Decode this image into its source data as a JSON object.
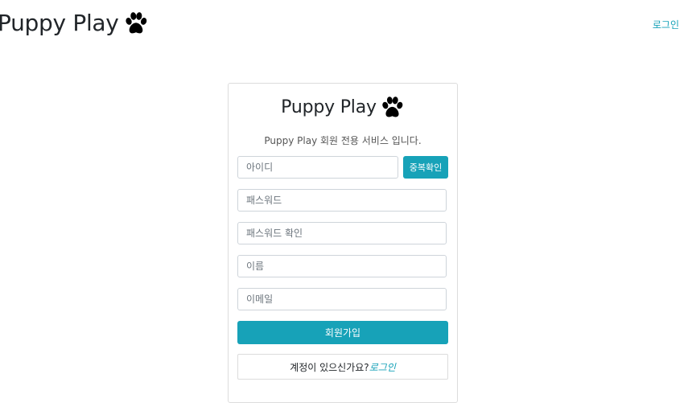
{
  "header": {
    "brand_title": "Puppy Play",
    "brand_icon": "paw-icon",
    "login_link": "로그인"
  },
  "card": {
    "title": "Puppy Play",
    "title_icon": "paw-icon",
    "subtitle": "Puppy Play 회원 전용 서비스 입니다.",
    "fields": {
      "id_placeholder": "아이디",
      "password_placeholder": "패스워드",
      "password_confirm_placeholder": "패스워드 확인",
      "name_placeholder": "이름",
      "email_placeholder": "이메일"
    },
    "check_duplicate_label": "중복확인",
    "signup_label": "회원가입",
    "account_prompt": "계정이 있으신가요?",
    "account_login_link": "로그인"
  },
  "colors": {
    "accent": "#17a2b8",
    "text": "#212529",
    "border": "#ced4da"
  }
}
